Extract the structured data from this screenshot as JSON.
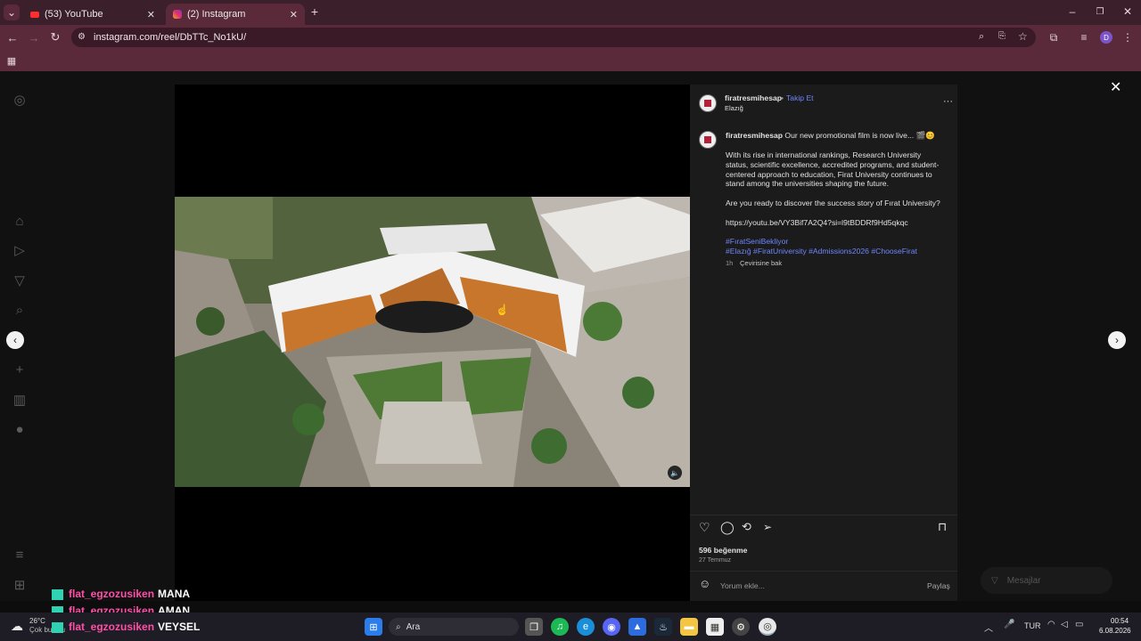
{
  "browser": {
    "tabs": [
      {
        "label": "(53) YouTube",
        "active": false,
        "icon": "youtube-icon"
      },
      {
        "label": "(2) Instagram",
        "active": true,
        "icon": "instagram-icon"
      }
    ],
    "url": "instagram.com/reel/DbTTc_No1kU/"
  },
  "post": {
    "username": "firatresmihesap",
    "follow_label": "Takip Et",
    "location": "Elazığ",
    "caption_intro": "Our new promotional film is now live... 🎬😊",
    "paragraph1": "With its rise in international rankings, Research University status, scientific excellence, accredited programs, and student-centered approach to education, Firat University continues to stand among the universities shaping the future.",
    "paragraph2": "Are you ready to discover the success story of Fırat University?",
    "link": "https://youtu.be/VY3Bif7A2Q4?si=l9tBDDRf9Hd5qkqc",
    "hashtags1": "#FıratSeniBekliyor",
    "hashtags2": "#Elazığ #FiratUniversity #Admissions2026 #ChooseFirat",
    "time": "1h",
    "translate_label": "Çevirisine bak",
    "likes": "596 beğenme",
    "date": "27 Temmuz",
    "comment_placeholder": "Yorum ekle...",
    "share_label": "Paylaş"
  },
  "messages": {
    "label": "Mesajlar"
  },
  "chat_overlay": [
    {
      "user": "flat_egzozusiken",
      "msg": "MANA"
    },
    {
      "user": "flat_egzozusiken",
      "msg": "AMAN"
    },
    {
      "user": "flat_egzozusiken",
      "msg": "VEYSEL"
    }
  ],
  "taskbar": {
    "weather_temp": "26°C",
    "weather_desc": "Çok bulutlu",
    "search_placeholder": "Ara",
    "lang": "TUR",
    "time": "00:54",
    "date": "6.08.2026"
  },
  "colors": {
    "accent_blue": "#6f86ff",
    "tabbar": "#3b1f2b",
    "toolbar": "#5a2a3b"
  }
}
